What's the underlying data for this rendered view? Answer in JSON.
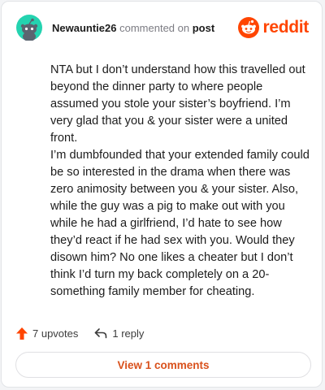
{
  "header": {
    "username": "Newauntie26",
    "action_text": "commented on",
    "post_link": "post",
    "logo_text": "reddit"
  },
  "comment": {
    "paragraphs": [
      "NTA but I don’t understand how this travelled out beyond the dinner party to where people assumed you stole your sister’s boyfriend. I’m very glad that you & your sister were a united front.",
      "I’m dumbfounded that your extended family could be so interested in the drama when there was zero animosity between you & your sister. Also, while the guy was a pig to make out with you while he had a girlfriend, I’d hate to see how they’d react if he had sex with you. Would they disown him? No one likes a cheater but I don’t think I’d turn my back completely on a 20-something family member for cheating."
    ]
  },
  "actions": {
    "upvotes_label": "7 upvotes",
    "reply_label": "1 reply"
  },
  "footer": {
    "view_comments_label": "View 1 comments"
  },
  "icons": {
    "avatar": "snoo-avatar-icon",
    "logo": "reddit-logo-icon",
    "upvote": "upvote-arrow-icon",
    "reply": "reply-arrow-icon"
  },
  "colors": {
    "brand": "#ff4500",
    "avatar_bg": "#24d3b0",
    "link": "#d9511c"
  }
}
